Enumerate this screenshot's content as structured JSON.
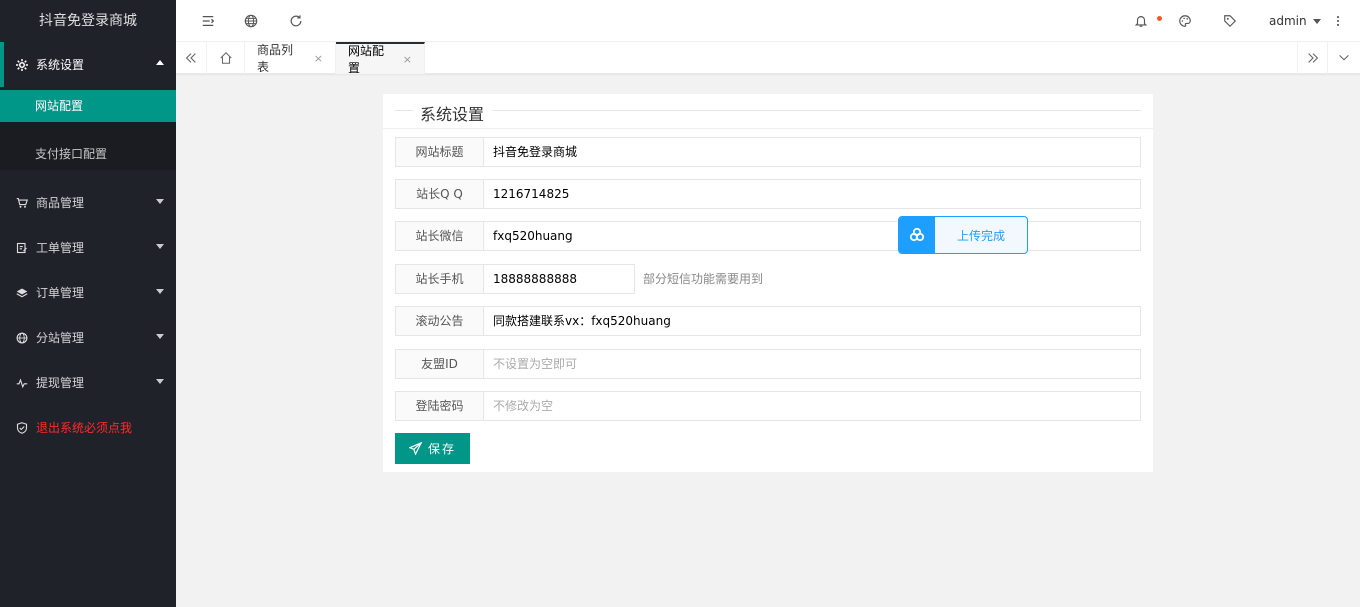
{
  "app": {
    "title": "抖音免登录商城"
  },
  "sidebar": {
    "items": [
      {
        "label": "系统设置",
        "icon": "gear-icon",
        "open": true,
        "children": [
          {
            "label": "网站配置",
            "active": true
          },
          {
            "label": "支付接口配置"
          }
        ]
      },
      {
        "label": "商品管理",
        "icon": "cart-icon"
      },
      {
        "label": "工单管理",
        "icon": "ticket-icon"
      },
      {
        "label": "订单管理",
        "icon": "layers-icon"
      },
      {
        "label": "分站管理",
        "icon": "globe-icon"
      },
      {
        "label": "提现管理",
        "icon": "pulse-icon"
      },
      {
        "label": "退出系统必须点我",
        "icon": "shield-icon",
        "color": "#ff2a2a"
      }
    ]
  },
  "header": {
    "user": "admin",
    "icons": [
      "menu-toggle-icon",
      "globe-icon",
      "refresh-icon",
      "bell-icon",
      "palette-icon",
      "tag-icon",
      "more-icon"
    ]
  },
  "tabs": {
    "items": [
      {
        "label": "商品列表",
        "close": "×"
      },
      {
        "label": "网站配置",
        "close": "×",
        "active": true
      }
    ]
  },
  "form": {
    "legend": "系统设置",
    "fields": [
      {
        "label": "网站标题",
        "value": "抖音免登录商城"
      },
      {
        "label": "站长Q Q",
        "value": "1216714825"
      },
      {
        "label": "站长微信",
        "value": "fxq520huang"
      },
      {
        "label": "站长手机",
        "value": "18888888888",
        "aux": "部分短信功能需要用到"
      },
      {
        "label": "滚动公告",
        "value": "同款搭建联系vx：fxq520huang"
      },
      {
        "label": "友盟ID",
        "value": "",
        "placeholder": "不设置为空即可"
      },
      {
        "label": "登陆密码",
        "value": "",
        "placeholder": "不修改为空"
      }
    ],
    "save_label": "保存"
  },
  "toast": {
    "text": "上传完成",
    "color": "#1e9fff"
  },
  "colors": {
    "accent": "#009688",
    "sidebar": "#20222a",
    "danger": "#ff2a2a"
  }
}
